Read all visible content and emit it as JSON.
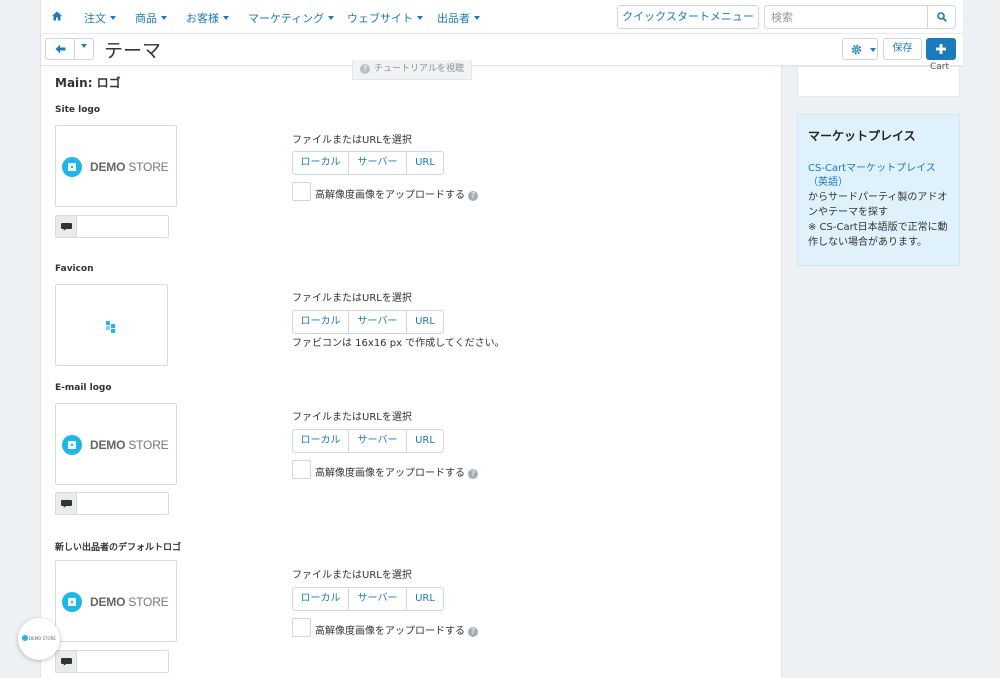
{
  "nav": {
    "items": [
      "注文",
      "商品",
      "お客様",
      "マーケティング",
      "ウェブサイト",
      "出品者"
    ],
    "quickstart": "クイックスタートメニュー",
    "search_placeholder": "検索"
  },
  "header": {
    "title": "テーマ",
    "save_label": "保存",
    "tutorial": "チュートリアルを視聴"
  },
  "sidebar": {
    "cart_text": "Cart",
    "market_title": "マーケットプレイス",
    "market_link": "CS-Cartマーケットプレイス（英語）",
    "market_desc": "からサードパーティ製のアドオンやテーマを探す",
    "market_note": "※ CS-Cart日本語版で正常に動作しない場合があります。"
  },
  "content": {
    "section_title": "Main: ロゴ",
    "file_label": "ファイルまたはURLを選択",
    "btn_local": "ローカル",
    "btn_server": "サーバー",
    "btn_url": "URL",
    "hidpi_label": "高解像度画像をアップロードする",
    "favicon_note": "ファビコンは 16x16 px で作成してください。",
    "logo_word_bold": "DEMO",
    "logo_word_light": " STORE",
    "help_glyph": "?",
    "sections": [
      {
        "title": "Site logo"
      },
      {
        "title": "Favicon"
      },
      {
        "title": "E-mail logo"
      },
      {
        "title": "新しい出品者のデフォルトロゴ"
      }
    ]
  },
  "floating": {
    "label": "DEMO STORE"
  },
  "colors": {
    "accent": "#1b7bbd",
    "logo_blue": "#1fb6e8",
    "sidebar_bg": "#dff1fb"
  }
}
